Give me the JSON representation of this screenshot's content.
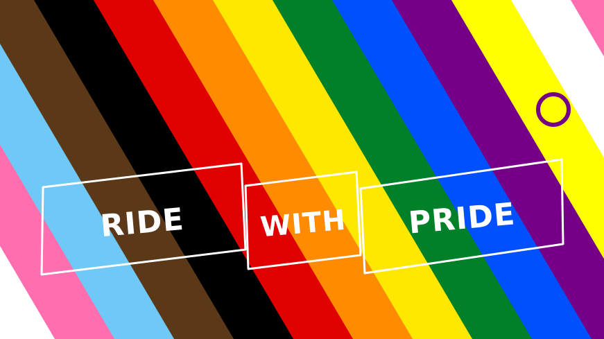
{
  "banner": {
    "word_1": "RIDE",
    "word_2": "WITH",
    "word_3": "PRIDE"
  },
  "flag_colors": [
    "#ff6fb0",
    "#6fc8f5",
    "#5a3818",
    "#000000",
    "#e00000",
    "#ff8c00",
    "#ffe800",
    "#008028",
    "#0050ff",
    "#750087",
    "#ffff00",
    "#ffffff",
    "#ff6fb0"
  ],
  "intersex_symbol_color": "#750087",
  "icon": "intersex-circle-icon"
}
